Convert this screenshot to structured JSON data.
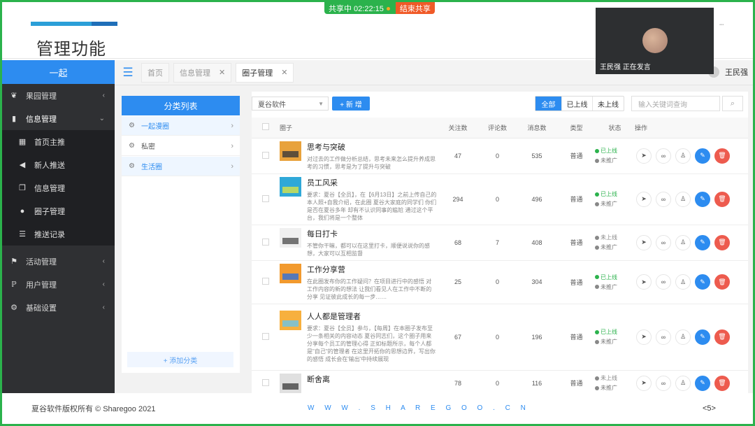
{
  "share": {
    "status": "共享中 02:22:15",
    "stop_label": "结束共享"
  },
  "page_title": "管理功能",
  "sidebar": {
    "brand": "一起",
    "items": [
      {
        "label": "果园管理",
        "icon": "leaf-icon",
        "chevron": "‹"
      },
      {
        "label": "信息管理",
        "icon": "book-icon",
        "chevron": "⌄"
      }
    ],
    "sub_items": [
      {
        "label": "首页主推",
        "icon": "grid-icon"
      },
      {
        "label": "新人推送",
        "icon": "megaphone-icon"
      },
      {
        "label": "信息管理",
        "icon": "copy-icon"
      },
      {
        "label": "圈子管理",
        "icon": "user-circle-icon"
      },
      {
        "label": "推送记录",
        "icon": "list-icon"
      }
    ],
    "items_after": [
      {
        "label": "活动管理",
        "icon": "flag-icon",
        "chevron": "‹"
      },
      {
        "label": "用户管理",
        "icon": "p-icon",
        "chevron": "‹"
      },
      {
        "label": "基础设置",
        "icon": "settings-icon",
        "chevron": "‹"
      }
    ]
  },
  "tabs": [
    {
      "label": "首页",
      "closable": false
    },
    {
      "label": "信息管理",
      "closable": true
    },
    {
      "label": "圈子管理",
      "closable": true
    }
  ],
  "user": {
    "name": "王民强"
  },
  "categories": {
    "title": "分类列表",
    "items": [
      "一起漫圈",
      "私密",
      "生活圈"
    ],
    "add_label": "+ 添加分类"
  },
  "toolbar": {
    "company": "夏谷软件",
    "new_label": "+ 新 增",
    "filters": [
      "全部",
      "已上线",
      "未上线"
    ],
    "search_placeholder": "输入关键词查询"
  },
  "table": {
    "headers": [
      "圈子",
      "关注数",
      "评论数",
      "消息数",
      "类型",
      "状态",
      "操作"
    ],
    "rows": [
      {
        "title": "思考与突破",
        "desc": "对过去的工作做分析总结，思考未来怎么提升养成思考的习惯，思考是为了提升与突破",
        "follow": "47",
        "comments": "0",
        "messages": "535",
        "type": "普通",
        "status1": "已上线",
        "status2": "未推广",
        "online": true
      },
      {
        "title": "员工风采",
        "desc": "要求：夏谷【全员】，在【6月13日】之前上传自己的本人照+自我介绍，在此圈 夏谷大家庭的同学们 你们是否在夏谷多年 却有不认识同事的尴尬 通过这个平台，我们将是一个整体",
        "follow": "294",
        "comments": "0",
        "messages": "496",
        "type": "普通",
        "status1": "已上线",
        "status2": "未推广",
        "online": true
      },
      {
        "title": "每日打卡",
        "desc": "不管你干嘛，都可以在这里打卡，顺便说说你的感想，大家可以互相监督",
        "follow": "68",
        "comments": "7",
        "messages": "408",
        "type": "普通",
        "status1": "未上线",
        "status2": "未推广",
        "online": false
      },
      {
        "title": "工作分享营",
        "desc": "在此圈发布你的工作疑问？在项目进行中的感悟 对工作内容的新的想法 让我们看见人在工作中不断的分享 见证彼此成长的每一步……",
        "follow": "25",
        "comments": "0",
        "messages": "304",
        "type": "普通",
        "status1": "已上线",
        "status2": "未推广",
        "online": true
      },
      {
        "title": "人人都是管理者",
        "desc": "要求：夏谷【全员】参与，【每周】在本圈子发布至少一条相关的内容动态 夏谷同志们，这个圈子用来分享每个员工的管理心得 正如标题所示，每个人都是\"自己\"的管理者 在这里开拓你的思想边界，写出你的感悟 成长会在'输出'中持续展现",
        "follow": "67",
        "comments": "0",
        "messages": "196",
        "type": "普通",
        "status1": "已上线",
        "status2": "未推广",
        "online": true
      },
      {
        "title": "断舍离",
        "desc": "",
        "follow": "78",
        "comments": "0",
        "messages": "116",
        "type": "普通",
        "status1": "未上线",
        "status2": "未推广",
        "online": false
      }
    ]
  },
  "video": {
    "speaker_label": "王民强 正在发言"
  },
  "footer": {
    "copyright": "夏谷软件版权所有 © Sharegoo 2021",
    "website": "W W W . S H A R E G O O . C N",
    "page": "<5>"
  },
  "colors": {
    "primary": "#2d8cf0",
    "sidebar": "#2f3033",
    "success": "#2bb24c",
    "danger": "#ed5b4e",
    "share_green": "#2bb24c",
    "share_orange": "#f05a28"
  }
}
